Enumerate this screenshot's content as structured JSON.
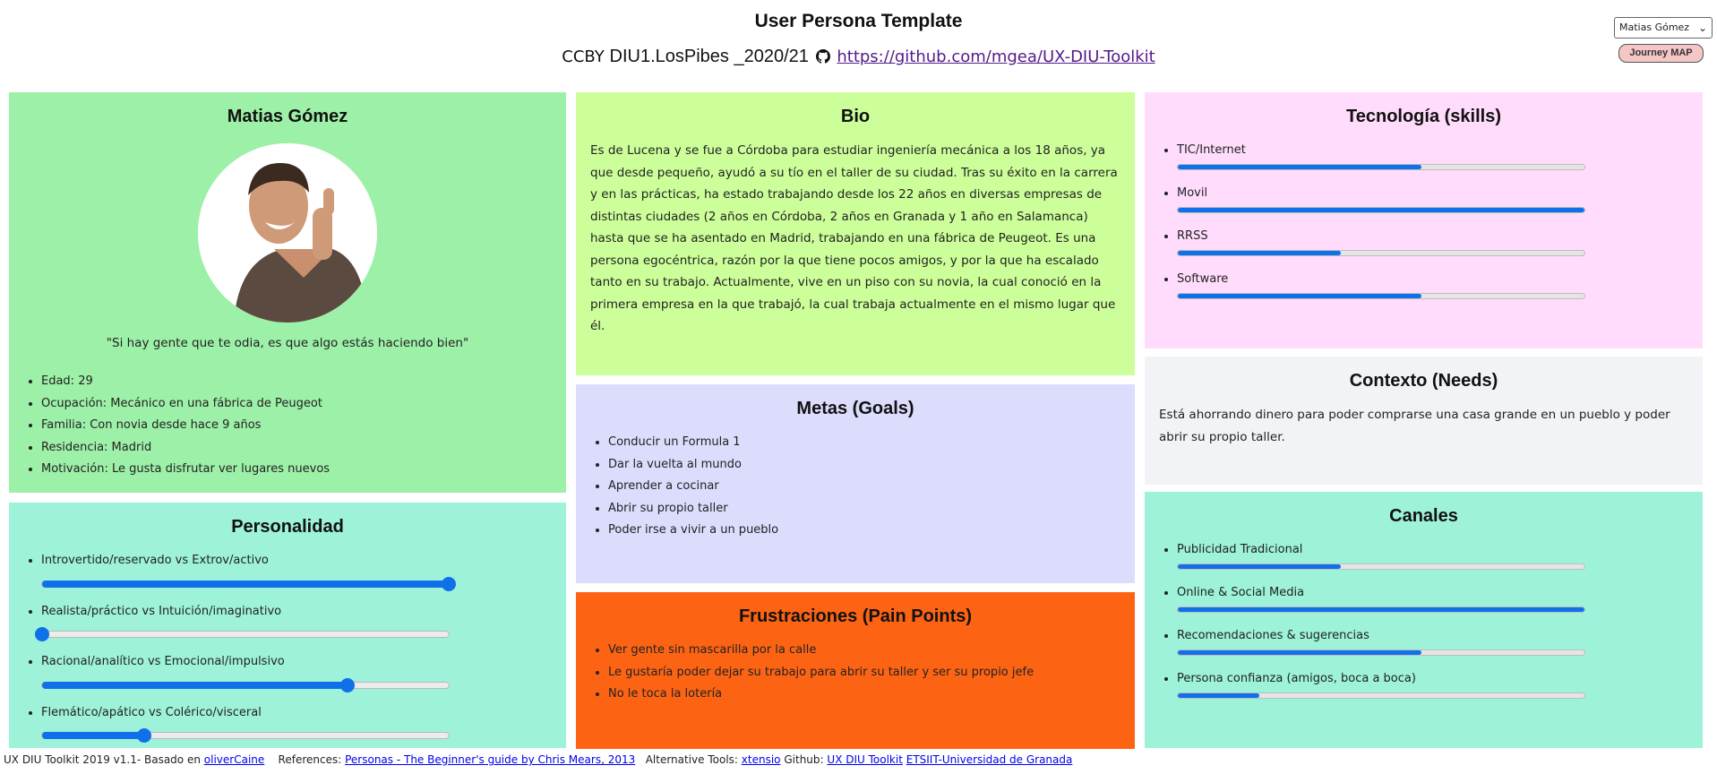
{
  "header": {
    "title": "User Persona Template",
    "license": "CCBY",
    "course": "DIU1.LosPibes _2020/21",
    "repo_link": "https://github.com/mgea/UX-DIU-Toolkit"
  },
  "controls": {
    "persona_select": "Matias Gómez",
    "journey_button": "Journey MAP"
  },
  "persona": {
    "name": "Matias Gómez",
    "quote": "\"Si hay gente que te odia, es que algo estás haciendo bien\"",
    "details": [
      "Edad: 29",
      "Ocupación: Mecánico en una fábrica de Peugeot",
      "Familia: Con novia desde hace 9 años",
      "Residencia: Madrid",
      "Motivación: Le gusta disfrutar ver lugares nuevos"
    ]
  },
  "bio": {
    "title": "Bio",
    "text": "Es de Lucena y se fue a Córdoba para estudiar ingeniería mecánica a los 18 años, ya que desde pequeño, ayudó a su tío en el taller de su ciudad. Tras su éxito en la carrera y en las prácticas, ha estado trabajando desde los 22 años en diversas empresas de distintas ciudades (2 años en Córdoba, 2 años en Granada y 1 año en Salamanca) hasta que se ha asentado en Madrid, trabajando en una fábrica de Peugeot. Es una persona egocéntrica, razón por la que tiene pocos amigos, y por la que ha escalado tanto en su trabajo. Actualmente, vive en un piso con su novia, la cual conoció en la primera empresa en la que trabajó, la cual trabaja actualmente en el mismo lugar que él."
  },
  "tech": {
    "title": "Tecnología (skills)",
    "items": [
      {
        "label": "TIC/Internet",
        "value": 0.6
      },
      {
        "label": "Movil",
        "value": 1.0
      },
      {
        "label": "RRSS",
        "value": 0.4
      },
      {
        "label": "Software",
        "value": 0.6
      }
    ]
  },
  "context": {
    "title": "Contexto (Needs)",
    "text": "Está ahorrando dinero para poder comprarse una casa grande en un pueblo y poder abrir su propio taller."
  },
  "goals": {
    "title": "Metas (Goals)",
    "items": [
      "Conducir un Formula 1",
      "Dar la vuelta al mundo",
      "Aprender a cocinar",
      "Abrir su propio taller",
      "Poder irse a vivir a un pueblo"
    ]
  },
  "personality": {
    "title": "Personalidad",
    "items": [
      {
        "label": "Introvertido/reservado vs Extrov/activo",
        "value": 1.0
      },
      {
        "label": "Realista/práctico vs Intuición/imaginativo",
        "value": 0.0
      },
      {
        "label": "Racional/analítico vs Emocional/impulsivo",
        "value": 0.75
      },
      {
        "label": "Flemático/apático vs Colérico/visceral",
        "value": 0.25
      }
    ]
  },
  "frustrations": {
    "title": "Frustraciones (Pain Points)",
    "items": [
      "Ver gente sin mascarilla por la calle",
      "Le gustaría poder dejar su trabajo para abrir su taller y ser su propio jefe",
      "No le toca la lotería"
    ]
  },
  "channels": {
    "title": "Canales",
    "items": [
      {
        "label": "Publicidad Tradicional",
        "value": 0.4
      },
      {
        "label": "Online & Social Media",
        "value": 1.0
      },
      {
        "label": "Recomendaciones & sugerencias",
        "value": 0.6
      },
      {
        "label": "Persona confianza (amigos, boca a boca)",
        "value": 0.2
      }
    ]
  },
  "footer": {
    "prefix": "UX DIU Toolkit 2019 v1.1- Basado en",
    "based_link": "oliverCaine",
    "refs_label": "References:",
    "refs_link": "Personas - The Beginner's guide by Chris Mears, 2013",
    "alt_label": "Alternative Tools:",
    "alt_link": "xtensio",
    "github_label": "Github:",
    "github_link": "UX DIU Toolkit",
    "univ_link": "ETSIIT-Universidad de Granada"
  },
  "colors": {
    "persona_bg": "#9df0a8",
    "bio_bg": "#ccff99",
    "tech_bg": "#ffdcfb",
    "context_bg": "#f1f3f7",
    "goals_bg": "#dcdcfd",
    "personality_bg": "#9df2d9",
    "frustrations_bg": "#fc6414",
    "channels_bg": "#9df2d9",
    "accent": "#1070ea"
  }
}
